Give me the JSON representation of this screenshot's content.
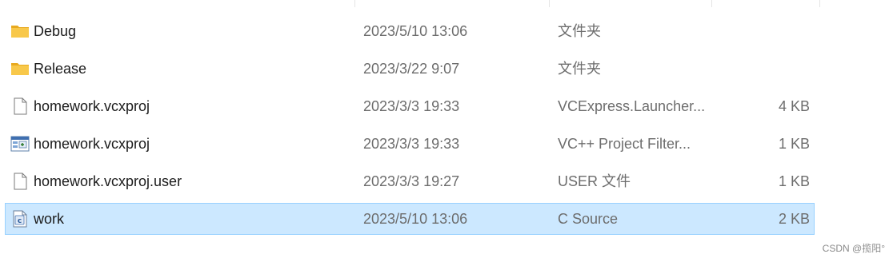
{
  "files": [
    {
      "name": "Debug",
      "date": "2023/5/10 13:06",
      "type": "文件夹",
      "size": "",
      "icon": "folder-icon"
    },
    {
      "name": "Release",
      "date": "2023/3/22 9:07",
      "type": "文件夹",
      "size": "",
      "icon": "folder-icon"
    },
    {
      "name": "homework.vcxproj",
      "date": "2023/3/3 19:33",
      "type": "VCExpress.Launcher...",
      "size": "4 KB",
      "icon": "generic-file-icon"
    },
    {
      "name": "homework.vcxproj",
      "date": "2023/3/3 19:33",
      "type": "VC++ Project Filter...",
      "size": "1 KB",
      "icon": "vc-filter-file-icon"
    },
    {
      "name": "homework.vcxproj.user",
      "date": "2023/3/3 19:27",
      "type": "USER 文件",
      "size": "1 KB",
      "icon": "generic-file-icon"
    },
    {
      "name": "work",
      "date": "2023/5/10 13:06",
      "type": "C Source",
      "size": "2 KB",
      "icon": "c-source-file-icon",
      "selected": true
    }
  ],
  "watermark": "CSDN @揽阳°",
  "colors": {
    "selection_bg": "#cce8ff",
    "selection_border": "#99d1ff",
    "folder": "#f8c84a",
    "secondary_text": "#6d6d6d"
  }
}
